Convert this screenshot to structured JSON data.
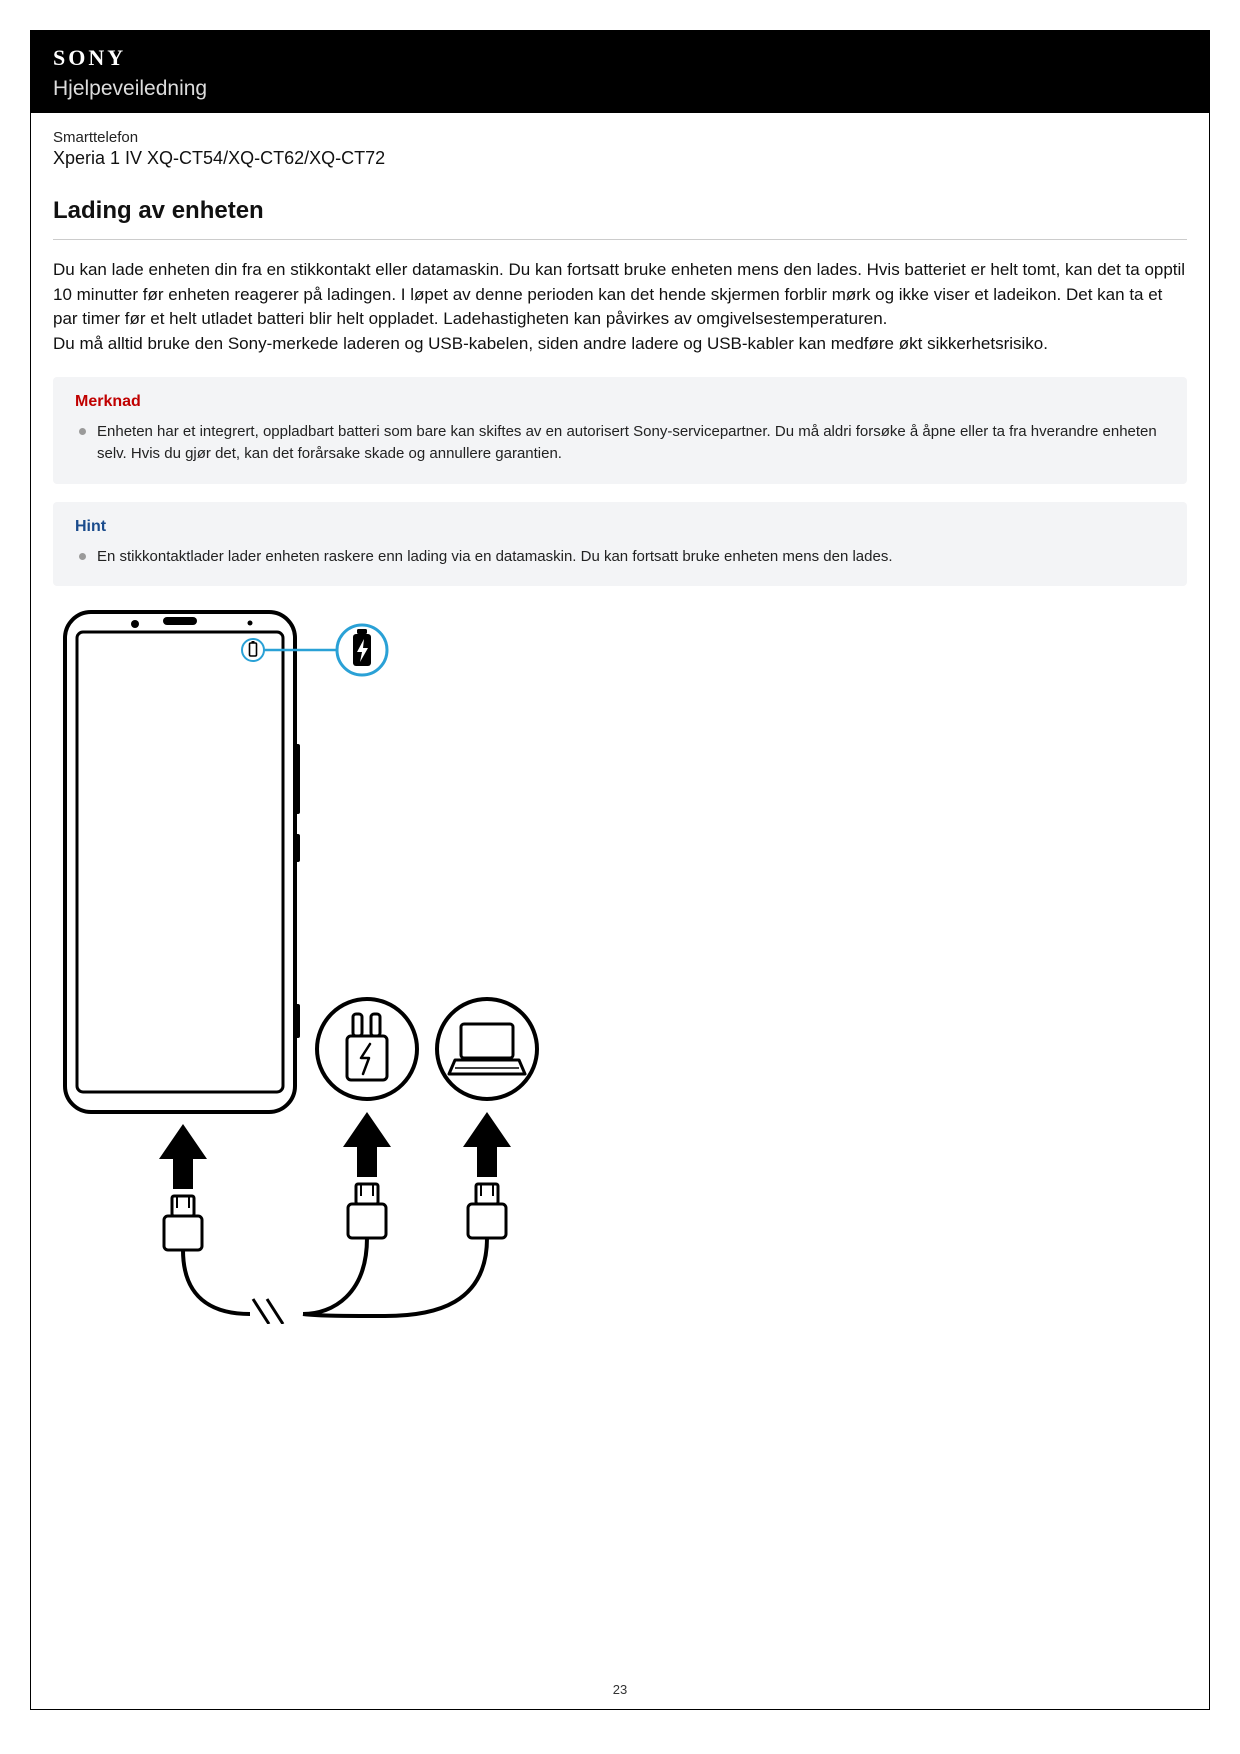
{
  "header": {
    "brand": "SONY",
    "guide": "Hjelpeveiledning"
  },
  "device": {
    "type": "Smarttelefon",
    "model": "Xperia 1 IV XQ-CT54/XQ-CT62/XQ-CT72"
  },
  "title": "Lading av enheten",
  "body": "Du kan lade enheten din fra en stikkontakt eller datamaskin. Du kan fortsatt bruke enheten mens den lades. Hvis batteriet er helt tomt, kan det ta opptil 10 minutter før enheten reagerer på ladingen. I løpet av denne perioden kan det hende skjermen forblir mørk og ikke viser et ladeikon. Det kan ta et par timer før et helt utladet batteri blir helt oppladet. Ladehastigheten kan påvirkes av omgivelsestemperaturen.\nDu må alltid bruke den Sony-merkede laderen og USB-kabelen, siden andre ladere og USB-kabler kan medføre økt sikkerhetsrisiko.",
  "note": {
    "title": "Merknad",
    "item": "Enheten har et integrert, oppladbart batteri som bare kan skiftes av en autorisert Sony-servicepartner. Du må aldri forsøke å åpne eller ta fra hverandre enheten selv. Hvis du gjør det, kan det forårsake skade og annullere garantien."
  },
  "hint": {
    "title": "Hint",
    "item": "En stikkontaktlader lader enheten raskere enn lading via en datamaskin. Du kan fortsatt bruke enheten mens den lades."
  },
  "pageNumber": "23"
}
